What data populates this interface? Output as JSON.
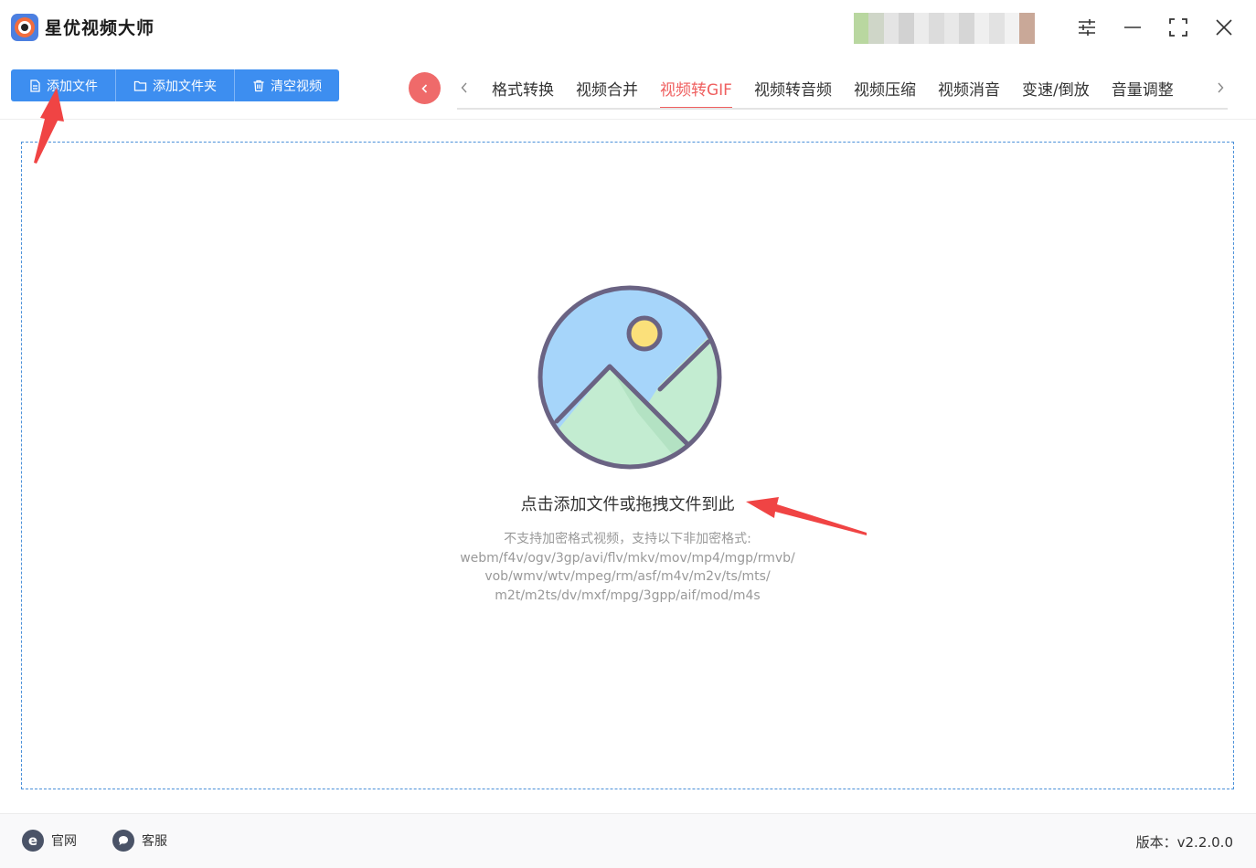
{
  "app": {
    "title": "星优视频大师",
    "logo_icon": "app-logo-icon"
  },
  "window_controls": {
    "settings_icon": "sliders-icon",
    "minimize_icon": "minimize-icon",
    "maximize_icon": "maximize-icon",
    "close_icon": "close-icon"
  },
  "toolbar": {
    "add_file": "添加文件",
    "add_folder": "添加文件夹",
    "clear_videos": "清空视频",
    "accent_color": "#3d8ef0"
  },
  "tabs": {
    "items": [
      "格式转换",
      "视频合并",
      "视频转GIF",
      "视频转音频",
      "视频压缩",
      "视频消音",
      "变速/倒放",
      "音量调整"
    ],
    "active": "视频转GIF",
    "active_color": "#ef5f5f"
  },
  "dropzone": {
    "title": "点击添加文件或拖拽文件到此",
    "notice": "不支持加密格式视频，支持以下非加密格式:",
    "formats_line1": "webm/f4v/ogv/3gp/avi/flv/mkv/mov/mp4/mgp/rmvb/",
    "formats_line2": "vob/wmv/wtv/mpeg/rm/asf/m4v/m2v/ts/mts/",
    "formats_line3": "m2t/m2ts/dv/mxf/mpg/3gpp/aif/mod/m4s"
  },
  "footer": {
    "website": "官网",
    "support": "客服",
    "version": "版本：v2.2.0.0"
  }
}
